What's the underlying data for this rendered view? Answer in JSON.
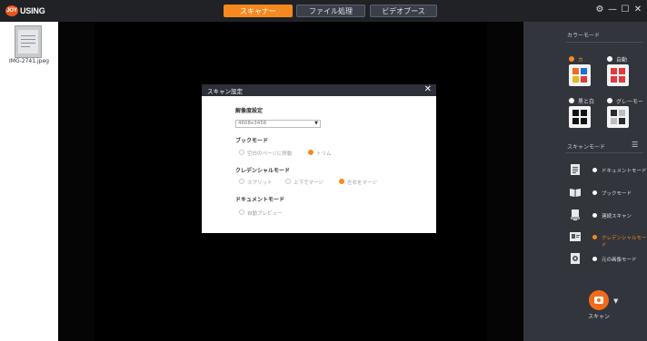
{
  "app": {
    "logo_mark": "JOY",
    "logo_text": "USING"
  },
  "tabs": [
    {
      "label": "スキャナー",
      "active": true
    },
    {
      "label": "ファイル処理",
      "active": false
    },
    {
      "label": "ビデオブース",
      "active": false
    }
  ],
  "window_controls": {
    "settings_glyph": "⚙",
    "minimize_glyph": "—",
    "maximize_glyph": "☐",
    "close_glyph": "✕"
  },
  "thumbnail": {
    "filename": "IMG-2741.jpeg"
  },
  "right_panel": {
    "color_mode_title": "カラーモード",
    "color_modes": [
      {
        "label": "カ",
        "selected": true,
        "icon": "color-grid-icon"
      },
      {
        "label": "自動",
        "selected": false,
        "icon": "auto-grid-icon"
      },
      {
        "label": "黒と白",
        "selected": false,
        "icon": "bw-grid-icon"
      },
      {
        "label": "グレーモード",
        "selected": false,
        "icon": "gray-grid-icon"
      }
    ],
    "scan_mode_title": "スキャンモード",
    "scan_modes": [
      {
        "label": "ドキュメントモード",
        "selected": false,
        "icon": "document-icon"
      },
      {
        "label": "ブックモード",
        "selected": false,
        "icon": "book-icon"
      },
      {
        "label": "連続スキャン",
        "selected": false,
        "icon": "stack-icon"
      },
      {
        "label": "クレデンシャルモード",
        "selected": true,
        "icon": "id-card-icon"
      },
      {
        "label": "元の画像モード",
        "selected": false,
        "icon": "original-image-icon"
      }
    ],
    "scan_button_label": "スキャン",
    "scan_caret": "▼",
    "filter_glyph": "☰"
  },
  "dialog": {
    "title": "スキャン設定",
    "close_glyph": "✕",
    "resolution_label": "解像度設定",
    "resolution_value": "4608x3456",
    "resolution_arrow": "▼",
    "book_mode_label": "ブックモード",
    "book_options": [
      {
        "label": "空白のページに移動",
        "selected": false
      },
      {
        "label": "トリム",
        "selected": true
      }
    ],
    "credential_label": "クレデンシャルモード",
    "credential_options": [
      {
        "label": "スプリット",
        "selected": false
      },
      {
        "label": "上下でマージ",
        "selected": false
      },
      {
        "label": "左右をマージ",
        "selected": true
      }
    ],
    "document_label": "ドキュメントモード",
    "document_options": [
      {
        "label": "自動プレビュー",
        "selected": false
      }
    ]
  },
  "colors": {
    "accent": "#f5891f",
    "titlebar": "#202226",
    "panel": "#32353c"
  }
}
